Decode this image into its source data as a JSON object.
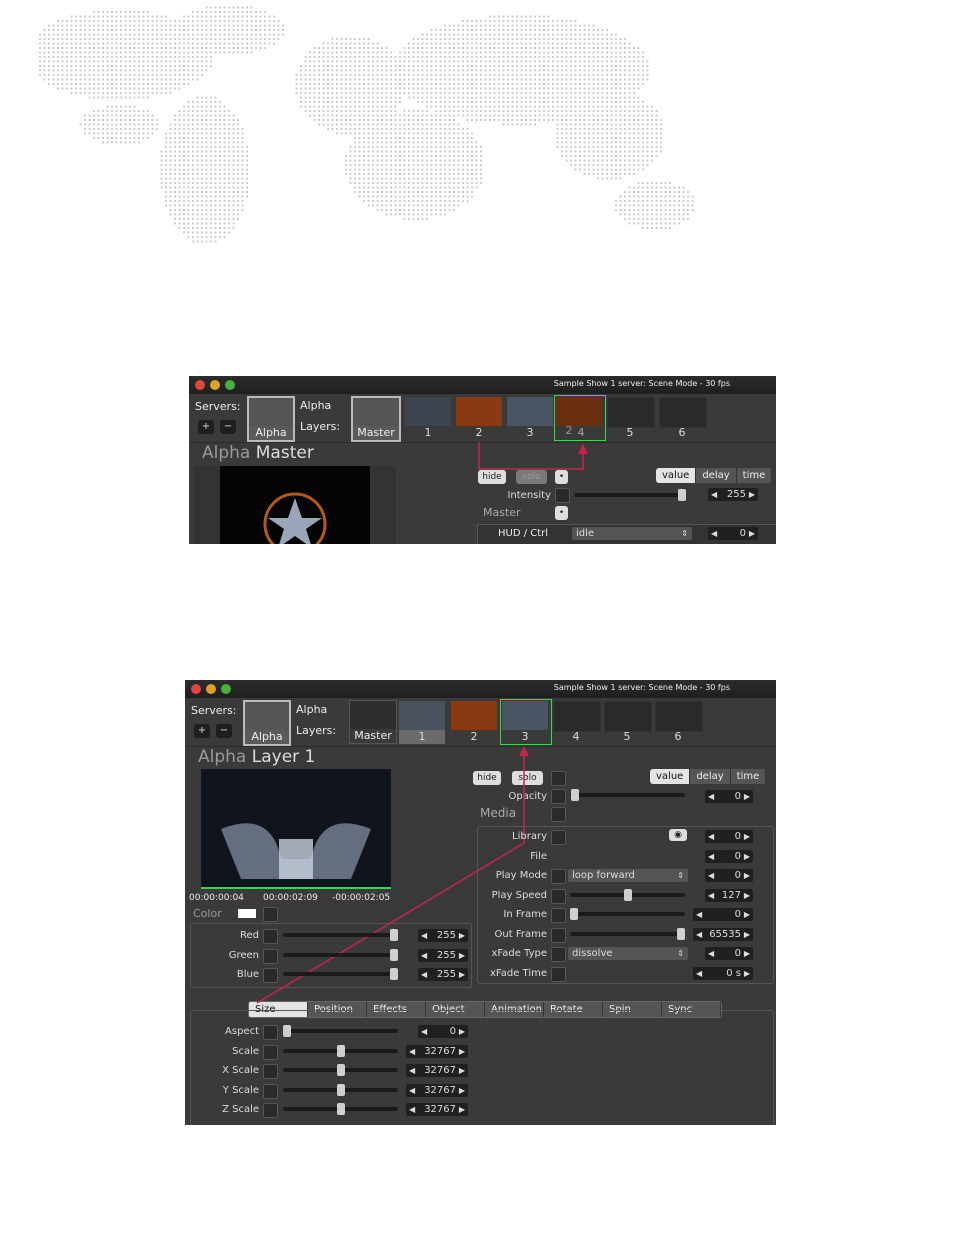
{
  "colors": {
    "accent_green": "#39d64a",
    "arrow": "#c8244a",
    "panel": "#3a3a3a"
  },
  "icons": {
    "close": "close-light",
    "minimize": "minimize-light",
    "zoom": "zoom-light",
    "eye": "eye-icon",
    "add": "plus-icon",
    "remove": "minus-icon"
  },
  "screen1": {
    "title": "Sample Show 1 server: Scene Mode - 30 fps",
    "servers_label": "Servers:",
    "add_symbol": "+",
    "remove_symbol": "−",
    "server_name": "Alpha",
    "server_thumb_caption": "Alpha",
    "layers_label": "Layers:",
    "master_caption": "Master",
    "layer_numbers": [
      "1",
      "2",
      "3",
      "4",
      "5",
      "6"
    ],
    "drag_overlay": "2",
    "head_dim": "Alpha",
    "head_main": "Master",
    "hide": "hide",
    "solo": "solo",
    "mode_tabs": [
      "value",
      "delay",
      "time"
    ],
    "intensity_label": "Intensity",
    "intensity_value": "255",
    "intensity_level": 1.0,
    "master_label": "Master",
    "hud_label": "HUD / Ctrl",
    "hud_select": "idle",
    "hud_value": "0"
  },
  "screen2": {
    "title": "Sample Show 1 server: Scene Mode - 30 fps",
    "servers_label": "Servers:",
    "add_symbol": "+",
    "remove_symbol": "−",
    "server_name": "Alpha",
    "server_thumb_caption": "Alpha",
    "layers_label": "Layers:",
    "master_caption": "Master",
    "layer_numbers": [
      "1",
      "2",
      "3",
      "4",
      "5",
      "6"
    ],
    "head_dim": "Alpha",
    "head_main": "Layer 1",
    "hide": "hide",
    "solo": "solo",
    "mode_tabs": [
      "value",
      "delay",
      "time"
    ],
    "opacity_label": "Opacity",
    "opacity_value": "0",
    "opacity_level": 0,
    "media_label": "Media",
    "timecodes": [
      "00:00:00:04",
      "00:00:02:09",
      "-00:00:02:05"
    ],
    "color_label": "Color",
    "color_rows": [
      {
        "label": "Red",
        "value": "255",
        "level": 1.0
      },
      {
        "label": "Green",
        "value": "255",
        "level": 1.0
      },
      {
        "label": "Blue",
        "value": "255",
        "level": 1.0
      }
    ],
    "media_rows": [
      {
        "label": "Library",
        "value": "0"
      },
      {
        "label": "File",
        "value": "0"
      },
      {
        "label": "Play Mode",
        "select": "loop forward",
        "value": "0"
      },
      {
        "label": "Play Speed",
        "value": "127",
        "level": 0.5
      },
      {
        "label": "In Frame",
        "value": "0",
        "level": 0
      },
      {
        "label": "Out Frame",
        "value": "65535",
        "level": 1.0
      },
      {
        "label": "xFade Type",
        "select": "dissolve",
        "value": "0"
      },
      {
        "label": "xFade Time",
        "value": "0 s"
      }
    ],
    "bottom_tabs": [
      "Size",
      "Position",
      "Effects",
      "Object",
      "Animation",
      "Rotate",
      "Spin",
      "Sync"
    ],
    "size_rows": [
      {
        "label": "Aspect",
        "value": "0",
        "level": 0
      },
      {
        "label": "Scale",
        "value": "32767",
        "level": 0.5
      },
      {
        "label": "X Scale",
        "value": "32767",
        "level": 0.5
      },
      {
        "label": "Y Scale",
        "value": "32767",
        "level": 0.5
      },
      {
        "label": "Z Scale",
        "value": "32767",
        "level": 0.5
      }
    ]
  }
}
